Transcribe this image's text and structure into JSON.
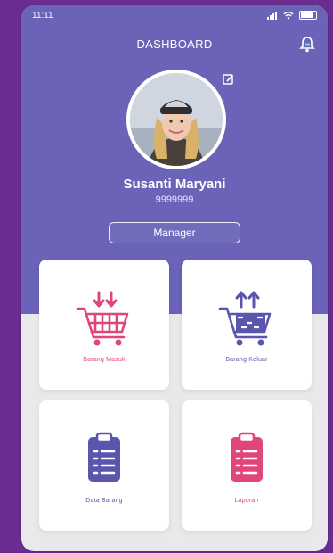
{
  "colors": {
    "page_bg": "#6a2c91",
    "header_bg": "#6a63b8",
    "accent_pink": "#e0457c",
    "accent_purple": "#5b56ad",
    "bell_green": "#7ee0a0"
  },
  "statusbar": {
    "time": "11:11"
  },
  "topbar": {
    "title": "DASHBOARD"
  },
  "profile": {
    "name": "Susanti Maryani",
    "id": "9999999",
    "role": "Manager"
  },
  "menu": [
    {
      "label": "Barang Masuk",
      "icon": "cart-arrow-down-icon",
      "color": "pink"
    },
    {
      "label": "Barang Keluar",
      "icon": "cart-arrow-up-icon",
      "color": "purple"
    },
    {
      "label": "Data Barang",
      "icon": "clipboard-icon",
      "color": "purple"
    },
    {
      "label": "Laporan",
      "icon": "clipboard-icon",
      "color": "pink"
    }
  ]
}
